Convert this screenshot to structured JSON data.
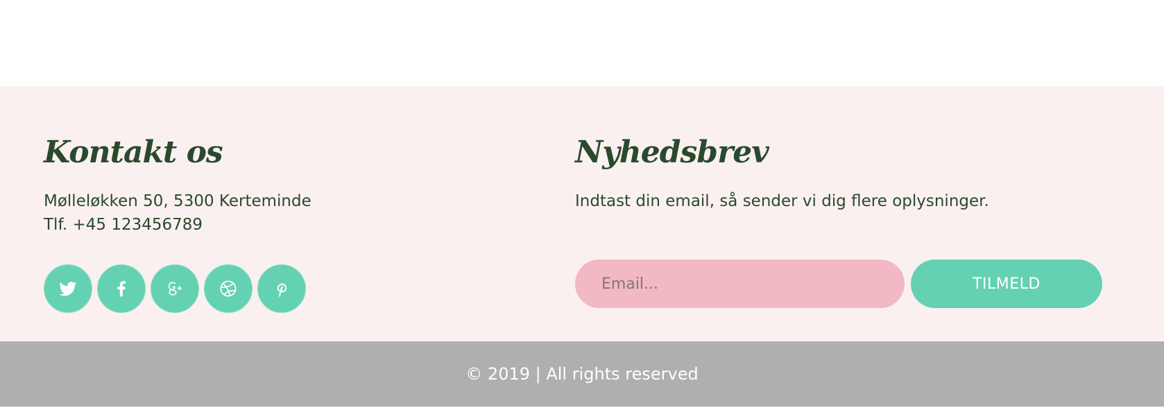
{
  "colors": {
    "footer_bg": "#fbf0f0",
    "green_dark": "#2a4a2c",
    "teal": "#64d1b3",
    "pink": "#f2b8c3",
    "grey": "#afafaf"
  },
  "contact": {
    "heading": "Kontakt os",
    "address": "Mølleløkken 50, 5300 Kerteminde",
    "phone": "Tlf. +45 123456789",
    "social": [
      {
        "icon": "twitter-icon"
      },
      {
        "icon": "facebook-icon"
      },
      {
        "icon": "google-plus-icon"
      },
      {
        "icon": "dribbble-icon"
      },
      {
        "icon": "pinterest-icon"
      }
    ]
  },
  "newsletter": {
    "heading": "Nyhedsbrev",
    "description": "Indtast din email, så sender vi dig flere oplysninger.",
    "email_placeholder": "Email...",
    "email_value": "",
    "button_label": "TILMELD"
  },
  "footer": {
    "copyright": "© 2019 | All rights reserved"
  }
}
